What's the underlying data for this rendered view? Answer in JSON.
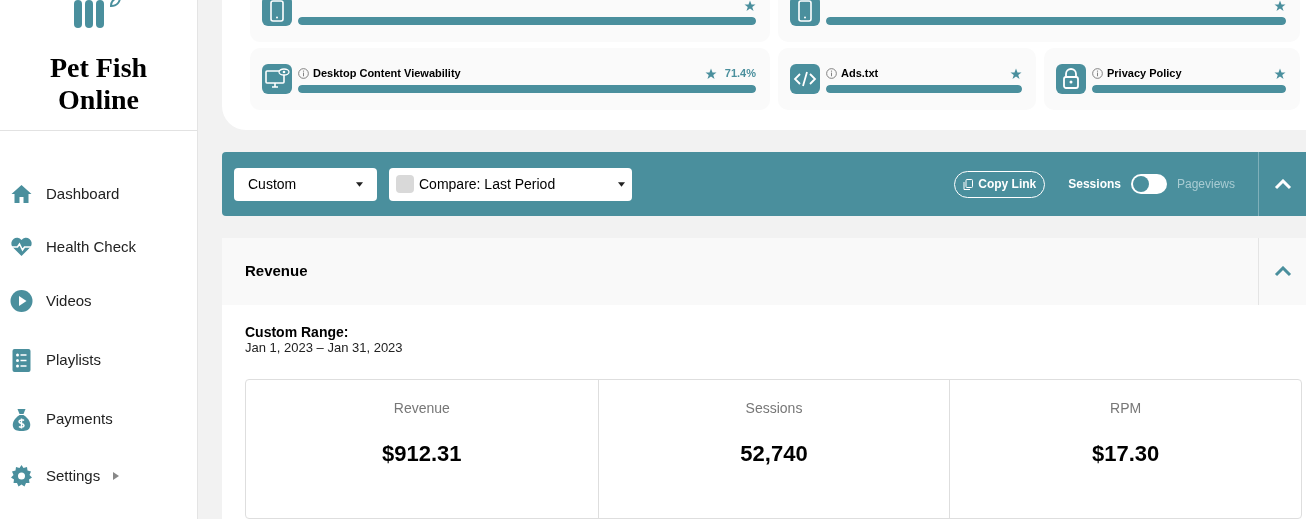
{
  "sidebar": {
    "title": "Pet Fish Online",
    "items": [
      {
        "label": "Dashboard",
        "kind": "home",
        "selected": false
      },
      {
        "label": "Health Check",
        "kind": "heart",
        "selected": false
      },
      {
        "label": "Videos",
        "kind": "play",
        "selected": false
      },
      {
        "label": "Playlists",
        "kind": "list",
        "selected": false
      },
      {
        "label": "Payments",
        "kind": "money",
        "selected": false
      },
      {
        "label": "Settings",
        "kind": "gear",
        "selected": false,
        "has_submenu": true
      }
    ]
  },
  "health_cards": [
    [
      {
        "kind": "phone",
        "level": 1,
        "starred": true
      },
      {
        "kind": "phone",
        "level": 1,
        "starred": true
      }
    ],
    [
      {
        "kind": "desktop",
        "label": "Desktop Content Viewability",
        "level": 1,
        "starred": true,
        "value": "71.4%"
      },
      {
        "kind": "code",
        "label": "Ads.txt",
        "level": 1,
        "starred": true
      },
      {
        "kind": "lock",
        "label": "Privacy Policy",
        "level": 1,
        "starred": true
      }
    ]
  ],
  "toolbar": {
    "range": "Custom",
    "compare": {
      "label": "Compare: Last Period",
      "checked": false
    },
    "copy_link": "Copy Link",
    "toggle": {
      "left": "Sessions",
      "right": "Pageviews",
      "on": false
    }
  },
  "revenue": {
    "title": "Revenue",
    "expanded": true,
    "range_label": "Custom Range:",
    "range": "Jan 1, 2023 – Jan 31, 2023",
    "metrics": [
      {
        "label": "Revenue",
        "value": "$912.31"
      },
      {
        "label": "Sessions",
        "value": "52,740"
      },
      {
        "label": "RPM",
        "value": "$17.30"
      }
    ]
  }
}
